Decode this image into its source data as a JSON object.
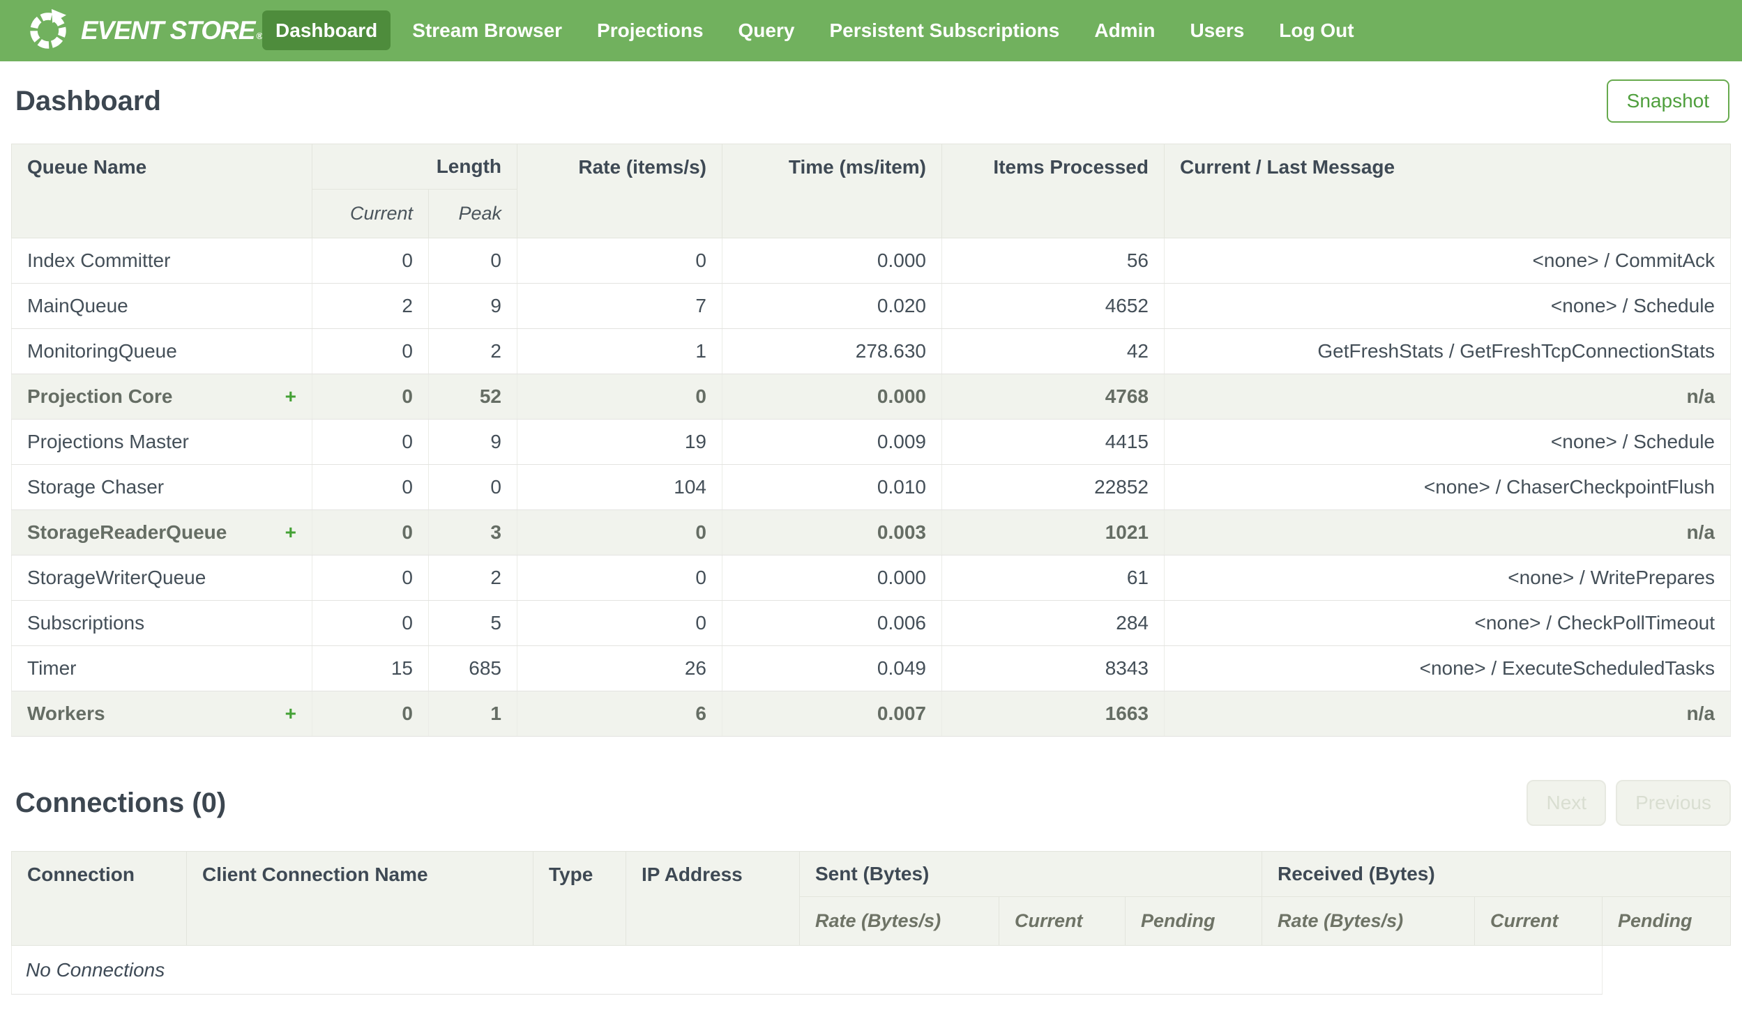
{
  "colors": {
    "nav-green": "#71b15e",
    "nav-active-green": "#4e8c3c",
    "accent-green": "#4f9f3d",
    "plus-green": "#44a135",
    "header-bg": "#f1f3ed"
  },
  "nav": {
    "brand": "EVENT STORE",
    "brand_mark": "®",
    "items": [
      {
        "label": "Dashboard",
        "active": true
      },
      {
        "label": "Stream Browser",
        "active": false
      },
      {
        "label": "Projections",
        "active": false
      },
      {
        "label": "Query",
        "active": false
      },
      {
        "label": "Persistent Subscriptions",
        "active": false
      },
      {
        "label": "Admin",
        "active": false
      },
      {
        "label": "Users",
        "active": false
      },
      {
        "label": "Log Out",
        "active": false
      }
    ]
  },
  "page": {
    "title": "Dashboard",
    "snapshot_label": "Snapshot"
  },
  "queue_table": {
    "expand_symbol": "+",
    "headers": {
      "queue_name": "Queue Name",
      "length": "Length",
      "current": "Current",
      "peak": "Peak",
      "rate": "Rate (items/s)",
      "time": "Time (ms/item)",
      "items_processed": "Items Processed",
      "message": "Current / Last Message"
    },
    "rows": [
      {
        "name": "Index Committer",
        "expandable": false,
        "current": "0",
        "peak": "0",
        "rate": "0",
        "time": "0.000",
        "items": "56",
        "message": "<none> / CommitAck"
      },
      {
        "name": "MainQueue",
        "expandable": false,
        "current": "2",
        "peak": "9",
        "rate": "7",
        "time": "0.020",
        "items": "4652",
        "message": "<none> / Schedule"
      },
      {
        "name": "MonitoringQueue",
        "expandable": false,
        "current": "0",
        "peak": "2",
        "rate": "1",
        "time": "278.630",
        "items": "42",
        "message": "GetFreshStats / GetFreshTcpConnectionStats"
      },
      {
        "name": "Projection Core",
        "expandable": true,
        "current": "0",
        "peak": "52",
        "rate": "0",
        "time": "0.000",
        "items": "4768",
        "message": "n/a"
      },
      {
        "name": "Projections Master",
        "expandable": false,
        "current": "0",
        "peak": "9",
        "rate": "19",
        "time": "0.009",
        "items": "4415",
        "message": "<none> / Schedule"
      },
      {
        "name": "Storage Chaser",
        "expandable": false,
        "current": "0",
        "peak": "0",
        "rate": "104",
        "time": "0.010",
        "items": "22852",
        "message": "<none> / ChaserCheckpointFlush"
      },
      {
        "name": "StorageReaderQueue",
        "expandable": true,
        "current": "0",
        "peak": "3",
        "rate": "0",
        "time": "0.003",
        "items": "1021",
        "message": "n/a"
      },
      {
        "name": "StorageWriterQueue",
        "expandable": false,
        "current": "0",
        "peak": "2",
        "rate": "0",
        "time": "0.000",
        "items": "61",
        "message": "<none> / WritePrepares"
      },
      {
        "name": "Subscriptions",
        "expandable": false,
        "current": "0",
        "peak": "5",
        "rate": "0",
        "time": "0.006",
        "items": "284",
        "message": "<none> / CheckPollTimeout"
      },
      {
        "name": "Timer",
        "expandable": false,
        "current": "15",
        "peak": "685",
        "rate": "26",
        "time": "0.049",
        "items": "8343",
        "message": "<none> / ExecuteScheduledTasks"
      },
      {
        "name": "Workers",
        "expandable": true,
        "current": "0",
        "peak": "1",
        "rate": "6",
        "time": "0.007",
        "items": "1663",
        "message": "n/a"
      }
    ]
  },
  "connections": {
    "title": "Connections (0)",
    "next_label": "Next",
    "previous_label": "Previous",
    "headers": {
      "connection": "Connection",
      "client_connection_name": "Client Connection Name",
      "type": "Type",
      "ip_address": "IP Address",
      "sent": "Sent (Bytes)",
      "received": "Received (Bytes)",
      "rate": "Rate (Bytes/s)",
      "current": "Current",
      "pending": "Pending"
    },
    "empty_message": "No Connections"
  }
}
